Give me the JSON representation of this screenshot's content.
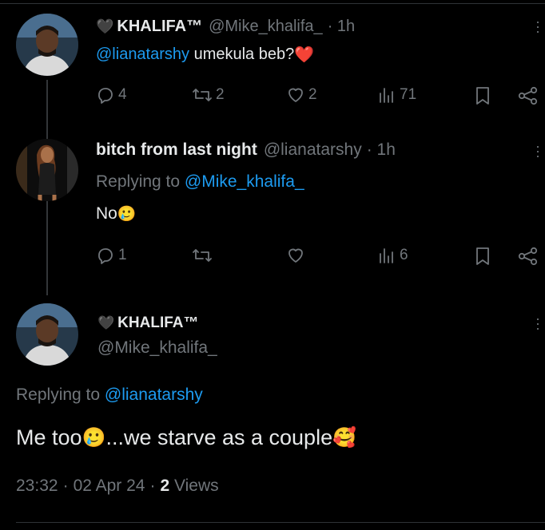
{
  "tweet1": {
    "heart_glyph": "🖤",
    "display_name": "KHALIFA™",
    "handle": "@Mike_khalifa_",
    "time": "· 1h",
    "mention": "@lianatarshy",
    "text": " umekula beb?",
    "emoji": "❤️",
    "replies": "4",
    "retweets": "2",
    "likes": "2",
    "views": "71"
  },
  "tweet2": {
    "display_name": "bitch from last night",
    "handle": "@lianatarshy",
    "time": "· 1h",
    "replying_prefix": "Replying to ",
    "replying_to": "@Mike_khalifa_",
    "text": "No",
    "emoji": "🥲",
    "replies": "1",
    "retweets": "",
    "likes": "",
    "views": "6"
  },
  "main_tweet": {
    "heart_glyph": "🖤",
    "display_name": "KHALIFA™",
    "handle": "@Mike_khalifa_",
    "replying_prefix": "Replying to ",
    "replying_to": "@lianatarshy",
    "text_part1": "Me too",
    "emoji1": "🥲",
    "text_part2": "...we starve as a couple",
    "emoji2": "🥰",
    "time": "23:32",
    "date": "02 Apr 24",
    "views_count": "2",
    "views_label": " Views"
  },
  "colors": {
    "background": "#000000",
    "text": "#e7e9ea",
    "muted": "#71767b",
    "link": "#1d9bf0"
  }
}
